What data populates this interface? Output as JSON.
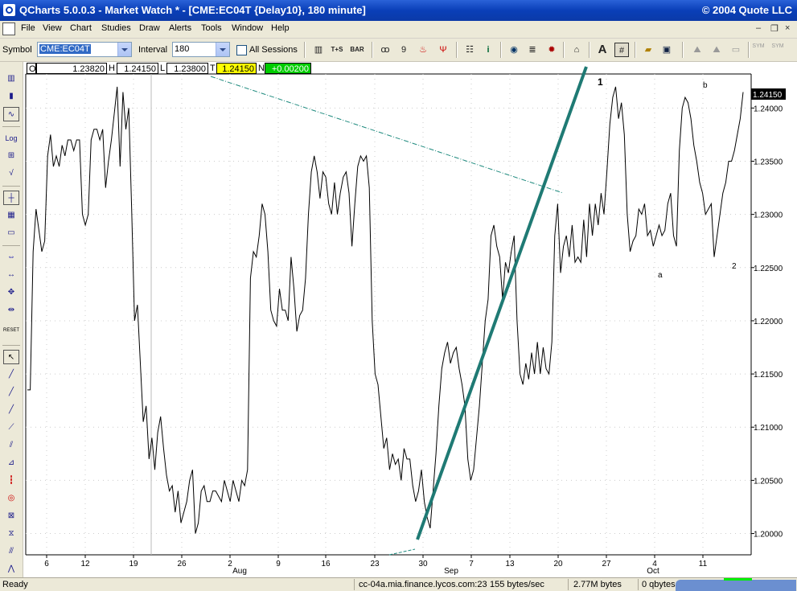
{
  "titlebar": {
    "title": "QCharts 5.0.0.3 - Market Watch * - [CME:EC04T {Delay10}, 180 minute]",
    "copyright": "© 2004 Quote LLC"
  },
  "menu": [
    "File",
    "View",
    "Chart",
    "Studies",
    "Draw",
    "Alerts",
    "Tools",
    "Window",
    "Help"
  ],
  "toolbar": {
    "symbol_label": "Symbol",
    "symbol_value": "CME:EC04T",
    "interval_label": "Interval",
    "interval_value": "180",
    "all_sessions_label": "All Sessions",
    "icons": [
      "T+S",
      "BAR"
    ],
    "sym_labels": [
      "SYM",
      "SYM"
    ]
  },
  "quote": {
    "o_label": "O",
    "o": "1.23820",
    "h_label": "H",
    "h": "1.24150",
    "l_label": "L",
    "l": "1.23800",
    "t_label": "T",
    "t": "1.24150",
    "n_label": "N",
    "n": "+0.00200"
  },
  "left_tools": {
    "log": "Log",
    "reset": "RESET"
  },
  "status": {
    "ready": "Ready",
    "server": "cc-04a.mia.finance.lycos.com:23",
    "rate": "155 bytes/sec",
    "mem": "2.77M bytes",
    "queue": "0 qbytes"
  },
  "chart_data": {
    "type": "line",
    "x_ticks": [
      "6",
      "12",
      "19",
      "26",
      "2",
      "9",
      "16",
      "23",
      "30",
      "7",
      "13",
      "20",
      "27",
      "4",
      "11"
    ],
    "month_labels": [
      "Aug",
      "Sep",
      "Oct"
    ],
    "y_ticks": [
      "1.24000",
      "1.23500",
      "1.23000",
      "1.22500",
      "1.22000",
      "1.21500",
      "1.21000",
      "1.20500",
      "1.20000"
    ],
    "ylim": [
      1.198,
      1.2432
    ],
    "last_price": "1.24150",
    "annotations": [
      "1",
      "a",
      "b",
      "2"
    ],
    "series": [
      {
        "values": [
          1.2135,
          1.2135,
          1.2265,
          1.2305,
          1.2285,
          1.2265,
          1.2275,
          1.2355,
          1.2375,
          1.2345,
          1.2355,
          1.2345,
          1.2365,
          1.2355,
          1.237,
          1.237,
          1.236,
          1.237,
          1.237,
          1.23,
          1.229,
          1.23,
          1.237,
          1.238,
          1.238,
          1.237,
          1.238,
          1.2325,
          1.235,
          1.237,
          1.2395,
          1.242,
          1.2345,
          1.2415,
          1.238,
          1.24,
          1.2305,
          1.22,
          1.2215,
          1.216,
          1.2105,
          1.212,
          1.207,
          1.209,
          1.206,
          1.2095,
          1.211,
          1.208,
          1.2055,
          1.204,
          1.2045,
          1.202,
          1.204,
          1.201,
          1.202,
          1.203,
          1.205,
          1.206,
          1.2,
          1.201,
          1.204,
          1.2045,
          1.203,
          1.203,
          1.204,
          1.204,
          1.2035,
          1.203,
          1.205,
          1.204,
          1.203,
          1.205,
          1.204,
          1.203,
          1.205,
          1.2045,
          1.206,
          1.224,
          1.2265,
          1.226,
          1.228,
          1.231,
          1.23,
          1.2265,
          1.221,
          1.22,
          1.2195,
          1.223,
          1.221,
          1.221,
          1.22,
          1.226,
          1.223,
          1.219,
          1.2205,
          1.221,
          1.224,
          1.23,
          1.234,
          1.2355,
          1.234,
          1.2315,
          1.234,
          1.2335,
          1.231,
          1.23,
          1.233,
          1.23,
          1.232,
          1.2335,
          1.234,
          1.232,
          1.227,
          1.231,
          1.2345,
          1.2355,
          1.235,
          1.2355,
          1.2325,
          1.22,
          1.215,
          1.214,
          1.211,
          1.208,
          1.209,
          1.206,
          1.2075,
          1.2065,
          1.207,
          1.205,
          1.208,
          1.207,
          1.207,
          1.2045,
          1.203,
          1.204,
          1.206,
          1.203,
          1.2015,
          1.2005,
          1.204,
          1.2075,
          1.212,
          1.2155,
          1.217,
          1.218,
          1.216,
          1.217,
          1.2175,
          1.2155,
          1.214,
          1.212,
          1.207,
          1.205,
          1.206,
          1.209,
          1.212,
          1.216,
          1.22,
          1.222,
          1.228,
          1.229,
          1.227,
          1.226,
          1.222,
          1.2255,
          1.2245,
          1.2265,
          1.228,
          1.22,
          1.215,
          1.214,
          1.216,
          1.2145,
          1.217,
          1.215,
          1.218,
          1.215,
          1.2175,
          1.2155,
          1.215,
          1.218,
          1.228,
          1.231,
          1.2245,
          1.227,
          1.228,
          1.226,
          1.229,
          1.2255,
          1.226,
          1.2255,
          1.2295,
          1.226,
          1.231,
          1.228,
          1.231,
          1.229,
          1.232,
          1.23,
          1.234,
          1.2385,
          1.241,
          1.242,
          1.239,
          1.2405,
          1.2375,
          1.23,
          1.2265,
          1.2275,
          1.228,
          1.2305,
          1.23,
          1.231,
          1.228,
          1.2285,
          1.227,
          1.228,
          1.229,
          1.228,
          1.2285,
          1.231,
          1.232,
          1.228,
          1.227,
          1.236,
          1.24,
          1.241,
          1.2405,
          1.239,
          1.2365,
          1.235,
          1.233,
          1.232,
          1.23,
          1.2305,
          1.231,
          1.226,
          1.228,
          1.23,
          1.232,
          1.233,
          1.235,
          1.235,
          1.236,
          1.2375,
          1.239,
          1.2415
        ]
      }
    ]
  }
}
